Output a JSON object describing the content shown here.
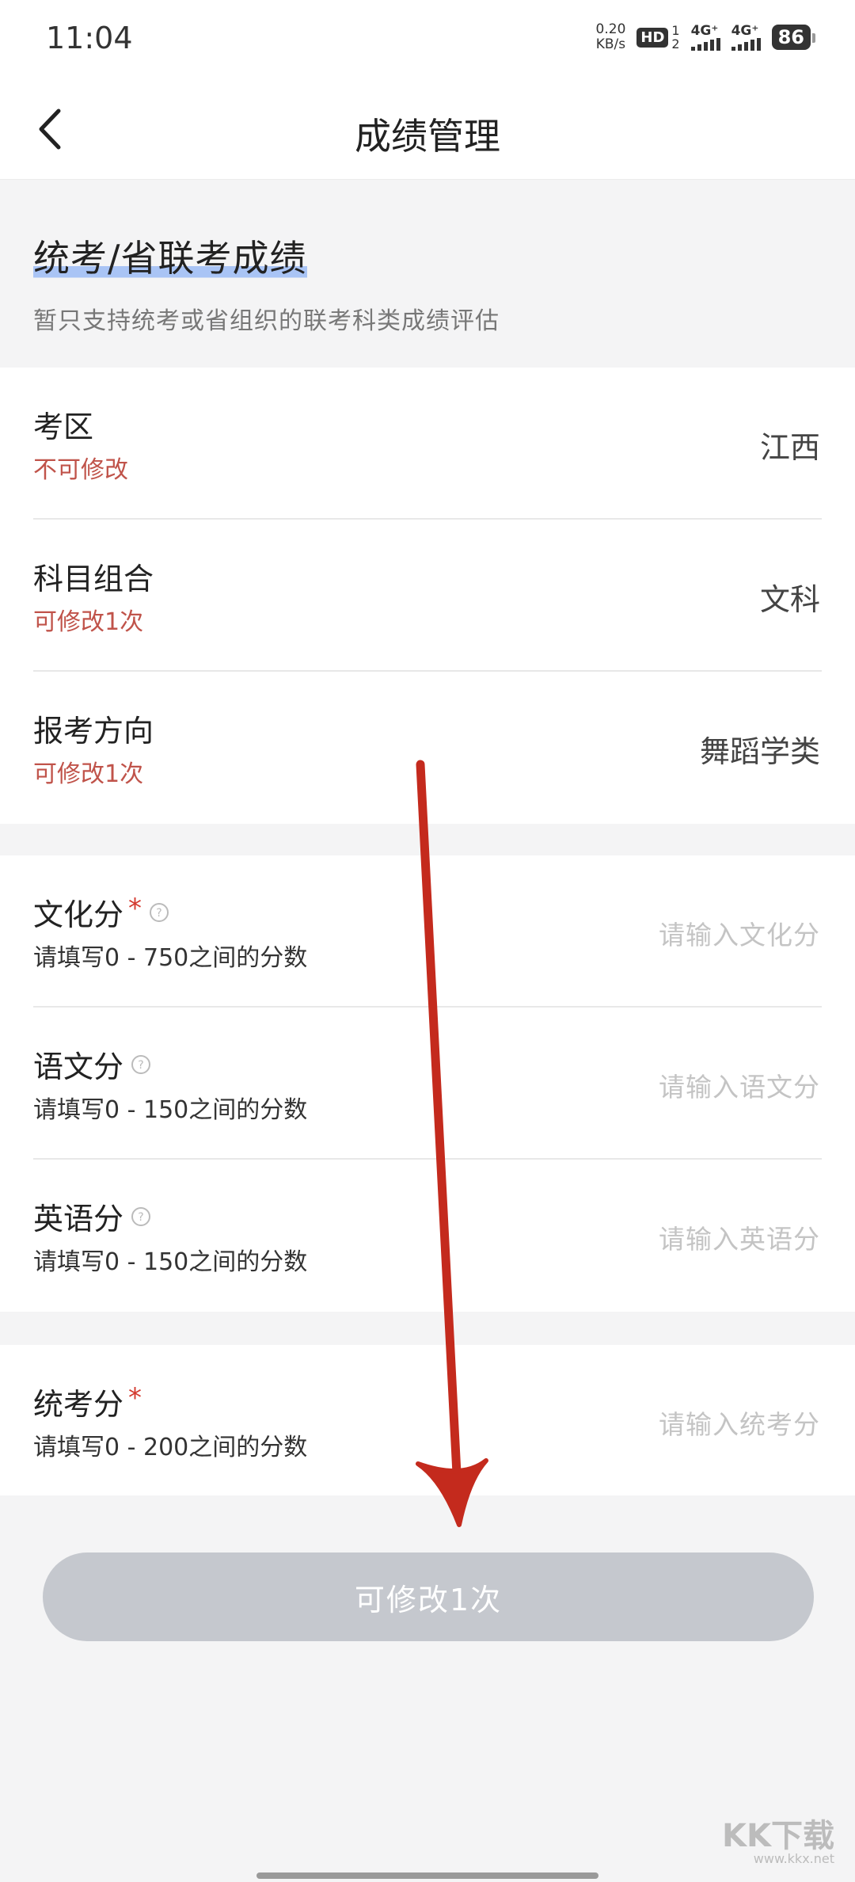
{
  "status_bar": {
    "time": "11:04",
    "net_speed_value": "0.20",
    "net_speed_unit": "KB/s",
    "hd_label": "HD",
    "sim_top": "1",
    "sim_bottom": "2",
    "signal1_label": "4G⁺",
    "signal2_label": "4G⁺",
    "battery": "86"
  },
  "nav": {
    "title": "成绩管理",
    "back_icon": "chevron-left-icon"
  },
  "intro": {
    "title": "统考/省联考成绩",
    "subtitle": "暂只支持统考或省组织的联考科类成绩评估"
  },
  "profile_rows": [
    {
      "label": "考区",
      "hint": "不可修改",
      "value": "江西"
    },
    {
      "label": "科目组合",
      "hint": "可修改1次",
      "value": "文科"
    },
    {
      "label": "报考方向",
      "hint": "可修改1次",
      "value": "舞蹈学类"
    }
  ],
  "score_rows": [
    {
      "label": "文化分",
      "required": "*",
      "hint": "请填写0 - 750之间的分数",
      "placeholder": "请输入文化分"
    },
    {
      "label": "语文分",
      "hint": "请填写0 - 150之间的分数",
      "placeholder": "请输入语文分"
    },
    {
      "label": "英语分",
      "hint": "请填写0 - 150之间的分数",
      "placeholder": "请输入英语分"
    }
  ],
  "exam_row": {
    "label": "统考分",
    "required": "*",
    "hint": "请填写0 - 200之间的分数",
    "placeholder": "请输入统考分"
  },
  "submit": {
    "label": "可修改1次"
  },
  "watermark": {
    "brand": "KK下载",
    "url": "www.kkx.net"
  },
  "colors": {
    "accent_red": "#d43a2f",
    "hint_red": "#c0534a",
    "button_disabled": "#c5c8ce",
    "highlight": "#a9c4f5",
    "arrow": "#c42a1d"
  }
}
